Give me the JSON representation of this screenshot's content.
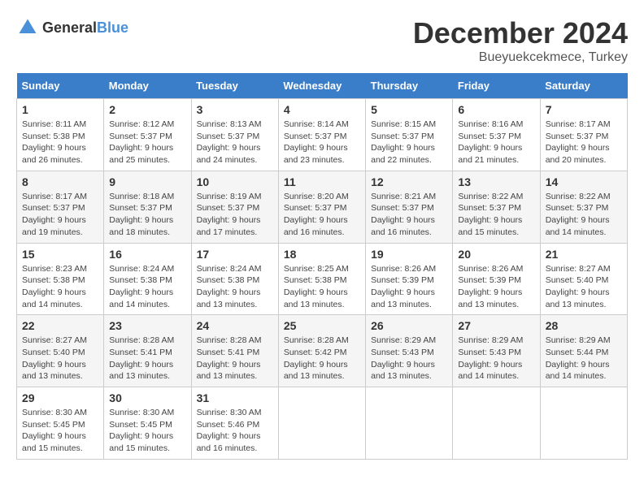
{
  "logo": {
    "text_general": "General",
    "text_blue": "Blue"
  },
  "title": {
    "month": "December 2024",
    "location": "Bueyuekcekmece, Turkey"
  },
  "weekdays": [
    "Sunday",
    "Monday",
    "Tuesday",
    "Wednesday",
    "Thursday",
    "Friday",
    "Saturday"
  ],
  "weeks": [
    [
      {
        "day": 1,
        "sunrise": "8:11 AM",
        "sunset": "5:38 PM",
        "daylight": "9 hours and 26 minutes."
      },
      {
        "day": 2,
        "sunrise": "8:12 AM",
        "sunset": "5:37 PM",
        "daylight": "9 hours and 25 minutes."
      },
      {
        "day": 3,
        "sunrise": "8:13 AM",
        "sunset": "5:37 PM",
        "daylight": "9 hours and 24 minutes."
      },
      {
        "day": 4,
        "sunrise": "8:14 AM",
        "sunset": "5:37 PM",
        "daylight": "9 hours and 23 minutes."
      },
      {
        "day": 5,
        "sunrise": "8:15 AM",
        "sunset": "5:37 PM",
        "daylight": "9 hours and 22 minutes."
      },
      {
        "day": 6,
        "sunrise": "8:16 AM",
        "sunset": "5:37 PM",
        "daylight": "9 hours and 21 minutes."
      },
      {
        "day": 7,
        "sunrise": "8:17 AM",
        "sunset": "5:37 PM",
        "daylight": "9 hours and 20 minutes."
      }
    ],
    [
      {
        "day": 8,
        "sunrise": "8:17 AM",
        "sunset": "5:37 PM",
        "daylight": "9 hours and 19 minutes."
      },
      {
        "day": 9,
        "sunrise": "8:18 AM",
        "sunset": "5:37 PM",
        "daylight": "9 hours and 18 minutes."
      },
      {
        "day": 10,
        "sunrise": "8:19 AM",
        "sunset": "5:37 PM",
        "daylight": "9 hours and 17 minutes."
      },
      {
        "day": 11,
        "sunrise": "8:20 AM",
        "sunset": "5:37 PM",
        "daylight": "9 hours and 16 minutes."
      },
      {
        "day": 12,
        "sunrise": "8:21 AM",
        "sunset": "5:37 PM",
        "daylight": "9 hours and 16 minutes."
      },
      {
        "day": 13,
        "sunrise": "8:22 AM",
        "sunset": "5:37 PM",
        "daylight": "9 hours and 15 minutes."
      },
      {
        "day": 14,
        "sunrise": "8:22 AM",
        "sunset": "5:37 PM",
        "daylight": "9 hours and 14 minutes."
      }
    ],
    [
      {
        "day": 15,
        "sunrise": "8:23 AM",
        "sunset": "5:38 PM",
        "daylight": "9 hours and 14 minutes."
      },
      {
        "day": 16,
        "sunrise": "8:24 AM",
        "sunset": "5:38 PM",
        "daylight": "9 hours and 14 minutes."
      },
      {
        "day": 17,
        "sunrise": "8:24 AM",
        "sunset": "5:38 PM",
        "daylight": "9 hours and 13 minutes."
      },
      {
        "day": 18,
        "sunrise": "8:25 AM",
        "sunset": "5:38 PM",
        "daylight": "9 hours and 13 minutes."
      },
      {
        "day": 19,
        "sunrise": "8:26 AM",
        "sunset": "5:39 PM",
        "daylight": "9 hours and 13 minutes."
      },
      {
        "day": 20,
        "sunrise": "8:26 AM",
        "sunset": "5:39 PM",
        "daylight": "9 hours and 13 minutes."
      },
      {
        "day": 21,
        "sunrise": "8:27 AM",
        "sunset": "5:40 PM",
        "daylight": "9 hours and 13 minutes."
      }
    ],
    [
      {
        "day": 22,
        "sunrise": "8:27 AM",
        "sunset": "5:40 PM",
        "daylight": "9 hours and 13 minutes."
      },
      {
        "day": 23,
        "sunrise": "8:28 AM",
        "sunset": "5:41 PM",
        "daylight": "9 hours and 13 minutes."
      },
      {
        "day": 24,
        "sunrise": "8:28 AM",
        "sunset": "5:41 PM",
        "daylight": "9 hours and 13 minutes."
      },
      {
        "day": 25,
        "sunrise": "8:28 AM",
        "sunset": "5:42 PM",
        "daylight": "9 hours and 13 minutes."
      },
      {
        "day": 26,
        "sunrise": "8:29 AM",
        "sunset": "5:43 PM",
        "daylight": "9 hours and 13 minutes."
      },
      {
        "day": 27,
        "sunrise": "8:29 AM",
        "sunset": "5:43 PM",
        "daylight": "9 hours and 14 minutes."
      },
      {
        "day": 28,
        "sunrise": "8:29 AM",
        "sunset": "5:44 PM",
        "daylight": "9 hours and 14 minutes."
      }
    ],
    [
      {
        "day": 29,
        "sunrise": "8:30 AM",
        "sunset": "5:45 PM",
        "daylight": "9 hours and 15 minutes."
      },
      {
        "day": 30,
        "sunrise": "8:30 AM",
        "sunset": "5:45 PM",
        "daylight": "9 hours and 15 minutes."
      },
      {
        "day": 31,
        "sunrise": "8:30 AM",
        "sunset": "5:46 PM",
        "daylight": "9 hours and 16 minutes."
      },
      null,
      null,
      null,
      null
    ]
  ]
}
